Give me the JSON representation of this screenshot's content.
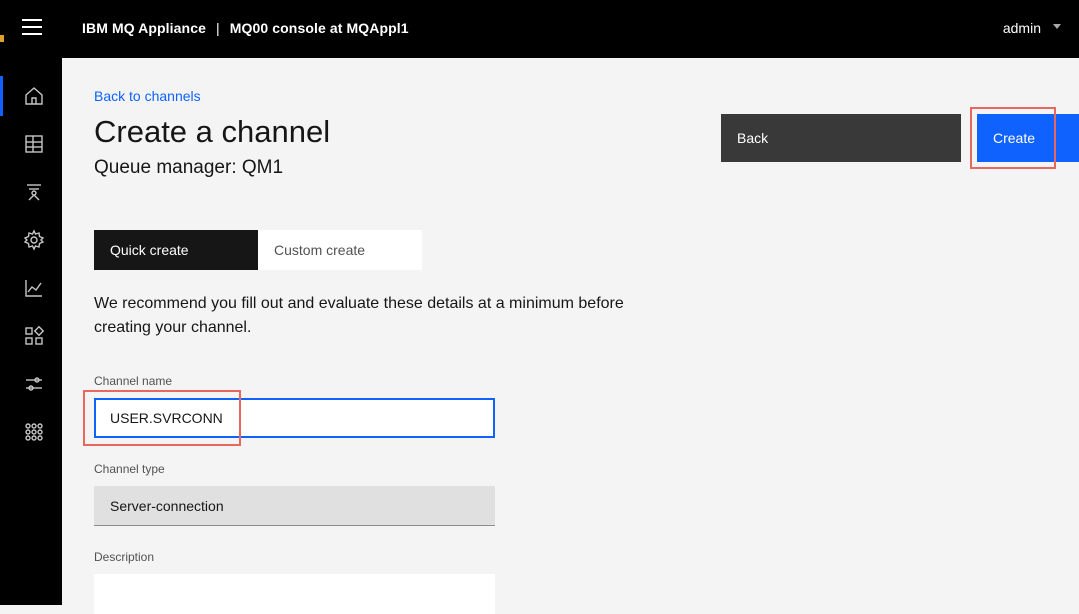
{
  "header": {
    "app_name": "IBM MQ Appliance",
    "separator": "|",
    "console_title": "MQ00 console at MQAppl1",
    "user": "admin"
  },
  "sidenav": {
    "items": [
      {
        "icon": "home-icon",
        "active": true
      },
      {
        "icon": "table-icon",
        "active": false
      },
      {
        "icon": "hierarchy-icon",
        "active": false
      },
      {
        "icon": "gear-icon",
        "active": false
      },
      {
        "icon": "chart-icon",
        "active": false
      },
      {
        "icon": "apps-icon",
        "active": false
      },
      {
        "icon": "sliders-icon",
        "active": false
      },
      {
        "icon": "network-icon",
        "active": false
      }
    ]
  },
  "page": {
    "back_link": "Back to channels",
    "title": "Create a channel",
    "subtitle": "Queue manager: QM1",
    "back_button": "Back",
    "create_button": "Create",
    "tabs": [
      "Quick create",
      "Custom create"
    ],
    "selected_tab": "Quick create",
    "intro": "We recommend you fill out and evaluate these details at a minimum before creating your channel."
  },
  "form": {
    "channel_name_label": "Channel name",
    "channel_name_value": "USER.SVRCONN",
    "channel_type_label": "Channel type",
    "channel_type_value": "Server-connection",
    "description_label": "Description",
    "description_value": ""
  },
  "colors": {
    "accent": "#0f62fe",
    "highlight": "#e8675e",
    "header_bg": "#000000"
  }
}
